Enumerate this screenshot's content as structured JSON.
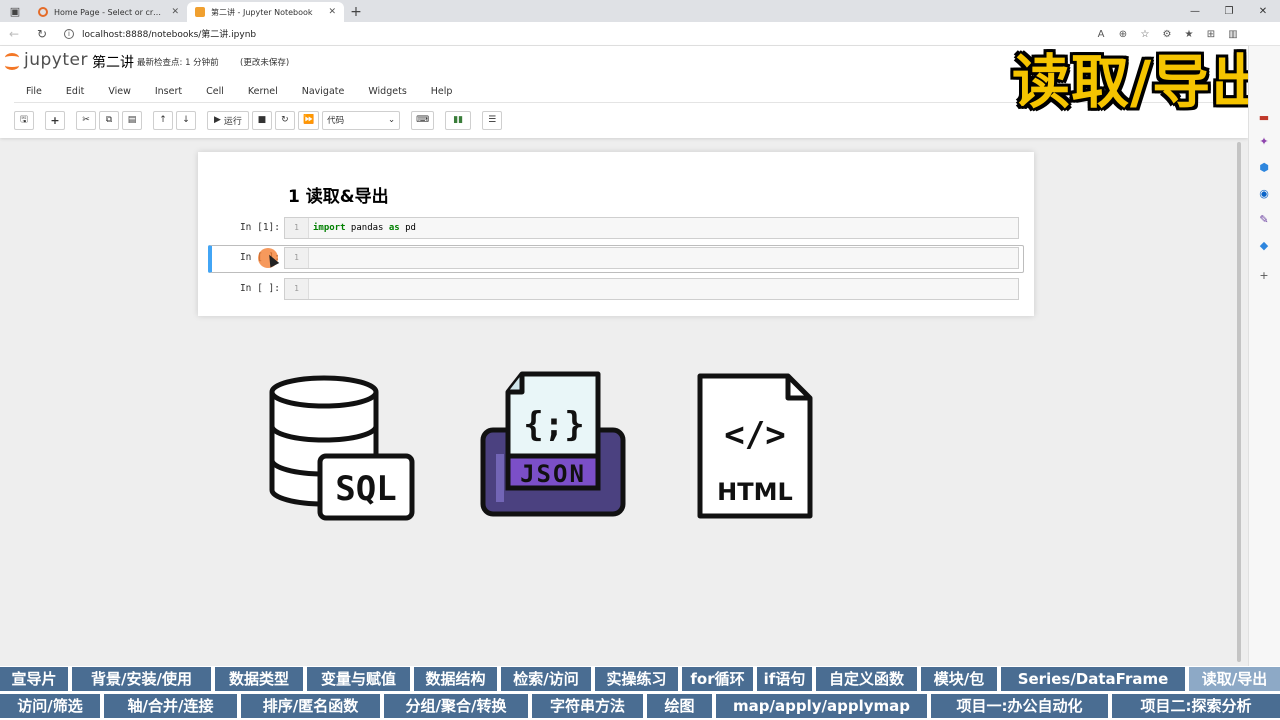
{
  "browser": {
    "tabs": [
      {
        "title": "Home Page - Select or create a n",
        "favicon_color": "#e46b28",
        "active": false
      },
      {
        "title": "第二讲 - Jupyter Notebook",
        "favicon_color": "#f0a030",
        "active": true
      }
    ],
    "url": "localhost:8888/notebooks/第二讲.ipynb"
  },
  "jupyter": {
    "logo_text": "jupyter",
    "notebook_name": "第二讲",
    "checkpoint": "最新检查点: 1 分钟前",
    "unsaved": "(更改未保存)",
    "menu": [
      "File",
      "Edit",
      "View",
      "Insert",
      "Cell",
      "Kernel",
      "Navigate",
      "Widgets",
      "Help"
    ],
    "toolbar": {
      "run_label": "运行",
      "cell_type": "代码"
    }
  },
  "overlay_title": "读取/导出",
  "notebook": {
    "heading": "1  读取&导出",
    "cells": [
      {
        "prompt": "In  [1]:",
        "line": "1",
        "code_kw": "import",
        "code_mid": " pandas ",
        "code_kw2": "as",
        "code_end": " pd"
      },
      {
        "prompt": "In  [ ]:",
        "line": "1"
      },
      {
        "prompt": "In  [ ]:",
        "line": "1"
      }
    ]
  },
  "illustrations": {
    "sql_label": "SQL",
    "json_label": "JSON",
    "json_glyph": "{;}",
    "html_label": "HTML",
    "html_glyph": "</>"
  },
  "course_nav": {
    "row1": [
      "宣导片",
      "背景/安装/使用",
      "数据类型",
      "变量与赋值",
      "数据结构",
      "检索/访问",
      "实操练习",
      "for循环",
      "if语句",
      "自定义函数",
      "模块/包",
      "Series/DataFrame",
      "读取/导出"
    ],
    "row2": [
      "访问/筛选",
      "轴/合并/连接",
      "排序/匿名函数",
      "分组/聚合/转换",
      "字符串方法",
      "绘图",
      "map/apply/applymap",
      "项目一:办公自动化",
      "项目二:探索分析"
    ],
    "current": "读取/导出"
  }
}
